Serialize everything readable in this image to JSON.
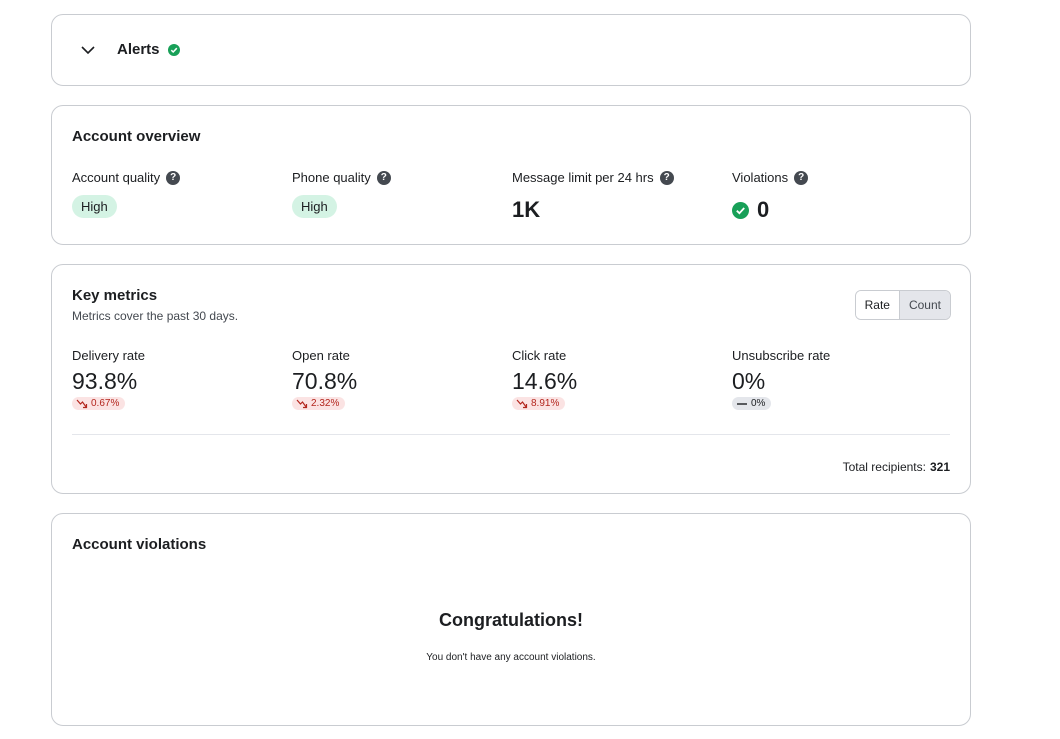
{
  "alerts": {
    "title": "Alerts",
    "status_color": "#18a058"
  },
  "overview": {
    "title": "Account overview",
    "account_quality": {
      "label": "Account quality",
      "value": "High"
    },
    "phone_quality": {
      "label": "Phone quality",
      "value": "High"
    },
    "message_limit": {
      "label": "Message limit per 24 hrs",
      "value": "1K"
    },
    "violations": {
      "label": "Violations",
      "value": "0"
    }
  },
  "metrics": {
    "title": "Key metrics",
    "subtitle": "Metrics cover the past 30 days.",
    "toggle": {
      "rate_label": "Rate",
      "count_label": "Count",
      "selected": "Rate"
    },
    "items": [
      {
        "label": "Delivery rate",
        "value": "93.8%",
        "delta": "0.67%",
        "trend": "down"
      },
      {
        "label": "Open rate",
        "value": "70.8%",
        "delta": "2.32%",
        "trend": "down"
      },
      {
        "label": "Click rate",
        "value": "14.6%",
        "delta": "8.91%",
        "trend": "down"
      },
      {
        "label": "Unsubscribe rate",
        "value": "0%",
        "delta": "0%",
        "trend": "flat"
      }
    ],
    "total_label": "Total recipients:",
    "total_value": "321"
  },
  "violations_card": {
    "title": "Account violations",
    "headline": "Congratulations!",
    "message": "You don't have any account violations."
  },
  "colors": {
    "success": "#18a058",
    "pill_bg": "#d4f3e4",
    "negative": "#b3261e",
    "negative_bg": "#fbe3e3"
  },
  "icons": [
    "chevron-down-icon",
    "check-circle-icon",
    "help-icon",
    "trend-down-icon",
    "trend-flat-icon"
  ]
}
